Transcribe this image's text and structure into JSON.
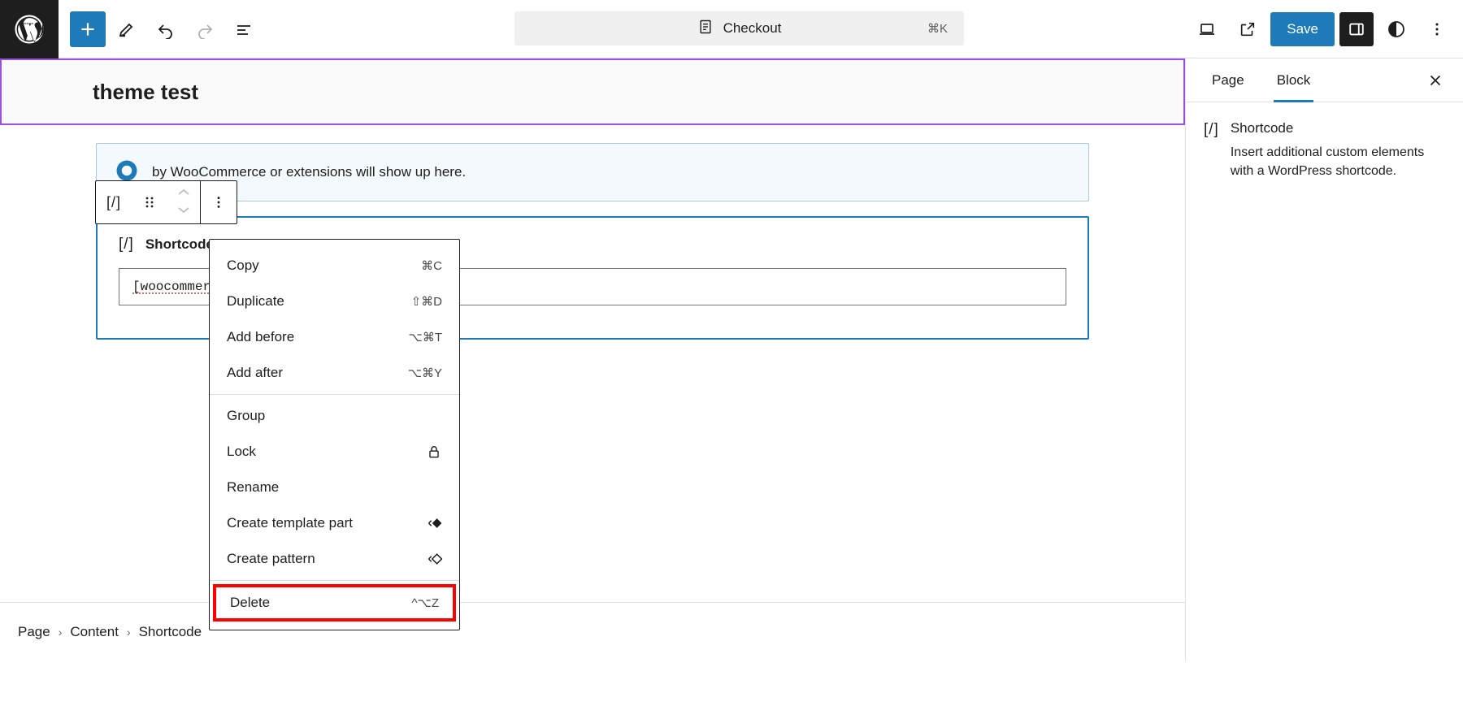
{
  "topbar": {
    "logo_icon": "wordpress-logo",
    "add_block_icon": "plus-icon",
    "edit_icon": "pencil-icon",
    "undo_icon": "undo-arrow-icon",
    "redo_icon": "redo-arrow-icon",
    "list_view_icon": "list-view-icon",
    "view_icon": "device-preview-icon",
    "external_icon": "external-link-icon",
    "save_label": "Save",
    "settings_icon": "sidebar-panel-icon",
    "styles_icon": "contrast-circle-icon",
    "options_icon": "more-vertical-icon",
    "accent_color": "#1e7ab8"
  },
  "document_bar": {
    "icon": "page-document-icon",
    "title": "Checkout",
    "shortcut": "⌘K"
  },
  "canvas": {
    "page_title": "theme test",
    "title_border_color": "#9b51e0",
    "notice": {
      "icon": "woocommerce-info-icon",
      "text": "by WooCommerce or extensions will show up here."
    },
    "block": {
      "icon_text": "[/]",
      "label": "Shortcode",
      "input_value": "[woocommer",
      "border_color": "#1e7ab8"
    }
  },
  "block_toolbar": {
    "block_type_icon": "shortcode-block-icon",
    "block_type_text": "[/]",
    "drag_icon": "drag-handle-icon",
    "move_up_icon": "chevron-up-icon",
    "move_down_icon": "chevron-down-icon",
    "options_icon": "more-vertical-icon"
  },
  "menu": {
    "groups": [
      {
        "items": [
          {
            "label": "Copy",
            "shortcut": "⌘C",
            "icon": ""
          },
          {
            "label": "Duplicate",
            "shortcut": "⇧⌘D",
            "icon": ""
          },
          {
            "label": "Add before",
            "shortcut": "⌥⌘T",
            "icon": ""
          },
          {
            "label": "Add after",
            "shortcut": "⌥⌘Y",
            "icon": ""
          }
        ]
      },
      {
        "items": [
          {
            "label": "Group",
            "shortcut": "",
            "icon": ""
          },
          {
            "label": "Lock",
            "shortcut": "",
            "icon": "lock-icon"
          },
          {
            "label": "Rename",
            "shortcut": "",
            "icon": ""
          },
          {
            "label": "Create template part",
            "shortcut": "",
            "icon": "template-part-icon"
          },
          {
            "label": "Create pattern",
            "shortcut": "",
            "icon": "pattern-icon"
          }
        ]
      },
      {
        "items": [
          {
            "label": "Delete",
            "shortcut": "^⌥Z",
            "icon": "",
            "highlight": true
          }
        ]
      }
    ],
    "highlight_color": "#ff0000"
  },
  "sidebar": {
    "tabs": [
      {
        "label": "Page",
        "active": false
      },
      {
        "label": "Block",
        "active": true
      }
    ],
    "close_icon": "close-icon",
    "card": {
      "icon_text": "[/]",
      "title": "Shortcode",
      "description": "Insert additional custom elements with a WordPress shortcode."
    }
  },
  "breadcrumb": {
    "items": [
      "Page",
      "Content",
      "Shortcode"
    ],
    "separator": "›"
  }
}
